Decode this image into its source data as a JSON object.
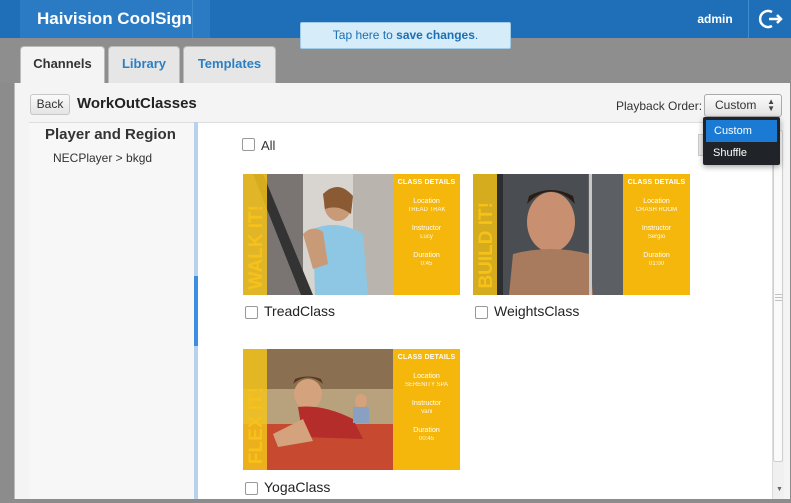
{
  "app": {
    "brand": "Haivision CoolSign",
    "user": "admin"
  },
  "banner": {
    "text_prefix": "Tap here to ",
    "text_bold": "save changes",
    "text_suffix": "."
  },
  "tabs": [
    {
      "label": "Channels"
    },
    {
      "label": "Library"
    },
    {
      "label": "Templates"
    }
  ],
  "toolbar": {
    "back_label": "Back",
    "title": "WorkOutClasses",
    "playback_label": "Playback Order:",
    "playback_value": "Custom",
    "playback_options": [
      "Custom",
      "Shuffle"
    ]
  },
  "left_pane": {
    "title": "Player and Region",
    "path": "NECPlayer > bkgd"
  },
  "content": {
    "all_label": "All"
  },
  "cards": [
    {
      "name": "TreadClass",
      "word": "WALK IT!",
      "header": "CLASS DETAILS",
      "location_label": "Location",
      "location": "TREAD TRAK",
      "instructor_label": "Instructor",
      "instructor": "Lucy",
      "duration_label": "Duration",
      "duration": "0:45"
    },
    {
      "name": "WeightsClass",
      "word": "BUILD IT!",
      "header": "CLASS DETAILS",
      "location_label": "Location",
      "location": "CRASH ROOM",
      "instructor_label": "Instructor",
      "instructor": "Sergio",
      "duration_label": "Duration",
      "duration": "01:00"
    },
    {
      "name": "YogaClass",
      "word": "FLEX IT!",
      "header": "CLASS DETAILS",
      "location_label": "Location",
      "location": "SERENITY SPA",
      "instructor_label": "Instructor",
      "instructor": "Vani",
      "duration_label": "Duration",
      "duration": "00:45"
    }
  ],
  "colors": {
    "brand_blue": "#1f6fb8",
    "accent_yellow": "#f6b70d",
    "selection_blue": "#1a7ad4"
  },
  "icons": {
    "logout": "logout-icon",
    "select_arrows": "updown-arrows-icon"
  }
}
